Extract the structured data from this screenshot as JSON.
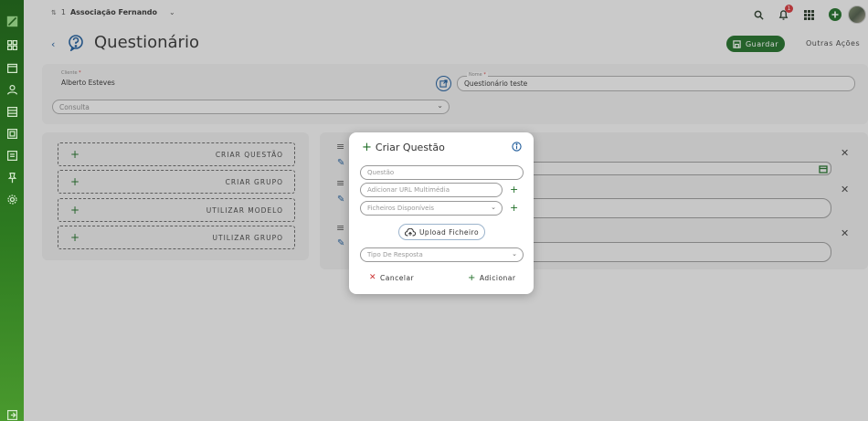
{
  "topbar": {
    "org_number": "1",
    "org_name": "Associação Fernando",
    "notifications_count": "1"
  },
  "header": {
    "title": "Questionário",
    "save_label": "Guardar",
    "other_actions_label": "Outras Ações"
  },
  "form": {
    "client_label": "Cliente",
    "client_value": "Alberto Esteves",
    "name_label": "Nome",
    "name_value": "Questionário teste",
    "type_placeholder": "Consulta"
  },
  "actions": [
    {
      "label": "CRIAR QUESTÃO"
    },
    {
      "label": "CRIAR GRUPO"
    },
    {
      "label": "UTILIZAR MODELO"
    },
    {
      "label": "UTILIZAR GRUPO"
    }
  ],
  "modal": {
    "title": "Criar Questão",
    "question_placeholder": "Questão",
    "url_placeholder": "Adicionar URL Multimédia",
    "files_placeholder": "Ficheiros Disponíveis",
    "upload_label": "Upload Ficheiro",
    "answer_type_placeholder": "Tipo De Resposta",
    "cancel_label": "Cancelar",
    "add_label": "Adicionar"
  },
  "colors": {
    "primary_green": "#1f6e27",
    "link_blue": "#1e5b9a",
    "badge_red": "#d4373a"
  }
}
